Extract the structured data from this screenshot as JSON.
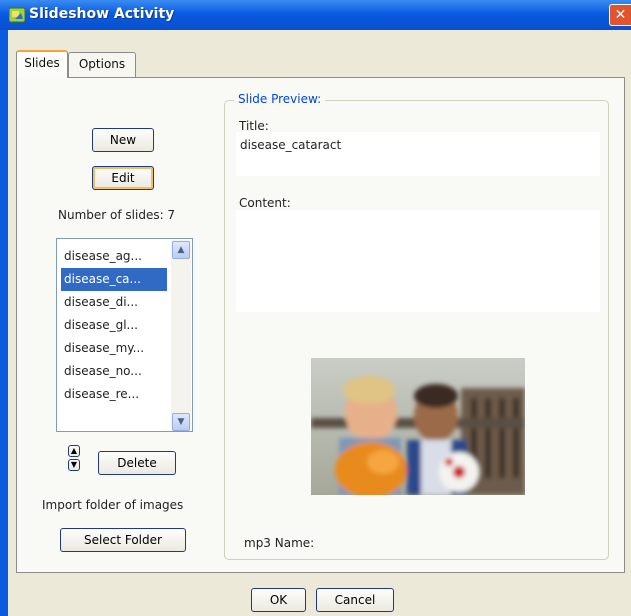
{
  "window": {
    "title": "Slideshow Activity",
    "close_glyph": "✕"
  },
  "tabs": [
    {
      "label": "Slides",
      "active": true
    },
    {
      "label": "Options",
      "active": false
    }
  ],
  "left": {
    "new_label": "New",
    "edit_label": "Edit",
    "slide_count_label": "Number of slides: 7",
    "slides": [
      "disease_ag...",
      "disease_ca...",
      "disease_di...",
      "disease_gl...",
      "disease_my...",
      "disease_no...",
      "disease_re..."
    ],
    "selected_index": 1,
    "delete_label": "Delete",
    "import_label": "Import folder of images",
    "select_folder_label": "Select Folder"
  },
  "preview": {
    "legend": "Slide Preview:",
    "title_label": "Title:",
    "title_value": "disease_cataract",
    "content_label": "Content:",
    "content_value": "",
    "mp3_label": "mp3 Name:"
  },
  "footer": {
    "ok_label": "OK",
    "cancel_label": "Cancel"
  },
  "colors": {
    "accent": "#0a5be0",
    "selection": "#316ac5",
    "legend": "#0046d5"
  }
}
